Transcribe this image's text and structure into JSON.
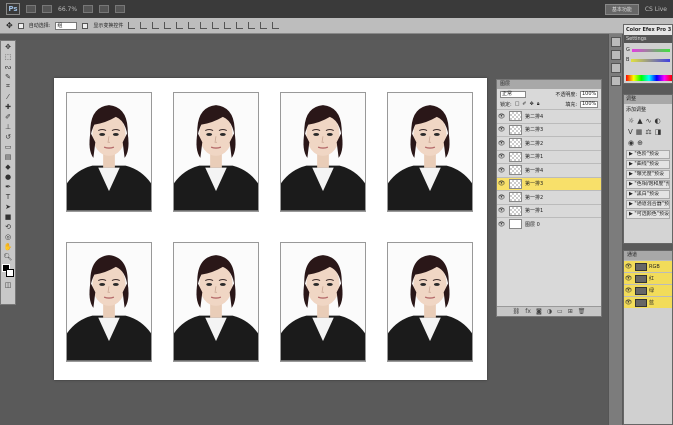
{
  "menubar": {
    "logo": "Ps",
    "zoom": "66.7%",
    "workspace": "基本功能",
    "cs_live": "CS Live"
  },
  "options": {
    "auto_select_label": "自动选择:",
    "auto_select_value": "组",
    "show_transform_label": "显示变换控件"
  },
  "canvas": {
    "photo_count": 8
  },
  "layers": {
    "tab_label": "图层",
    "blend_mode": "正常",
    "opacity_label": "不透明度:",
    "opacity_value": "100%",
    "lock_label": "锁定:",
    "fill_label": "填充:",
    "fill_value": "100%",
    "items": [
      {
        "name": "第二排4",
        "active": false
      },
      {
        "name": "第二排3",
        "active": false
      },
      {
        "name": "第二排2",
        "active": false
      },
      {
        "name": "第二排1",
        "active": false
      },
      {
        "name": "第一排4",
        "active": false
      },
      {
        "name": "第一排3",
        "active": true
      },
      {
        "name": "第一排2",
        "active": false
      },
      {
        "name": "第一排1",
        "active": false
      },
      {
        "name": "图层 0",
        "active": false
      }
    ]
  },
  "colorefex": {
    "title": "Color Efex Pro 3",
    "subtitle": "Settings",
    "slider_g": "G",
    "slider_b": "B"
  },
  "adjust": {
    "tab_label": "调整",
    "title": "添加调整",
    "presets": [
      "\"色阶\"预设",
      "\"曲线\"预设",
      "\"曝光度\"预设",
      "\"色相/饱和度\"预设",
      "\"黑白\"预设",
      "\"通道混合器\"预设",
      "\"可选颜色\"预设"
    ]
  },
  "channels": {
    "tab_label": "通道",
    "items": [
      "RGB",
      "红",
      "绿",
      "蓝"
    ]
  },
  "colors": {
    "active_layer": "#f8e06a",
    "ui_dark": "#3a3a3a"
  }
}
